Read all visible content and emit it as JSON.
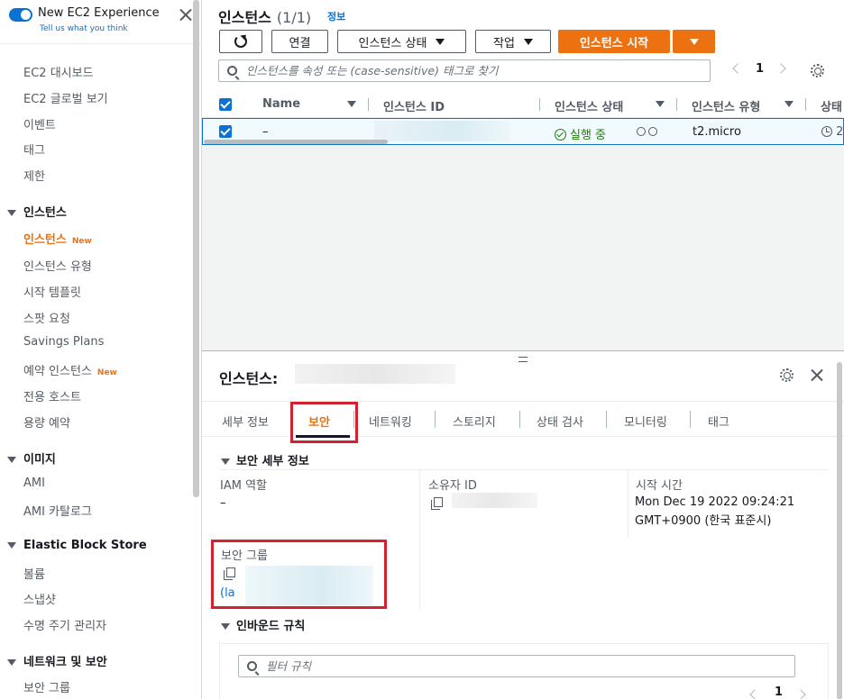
{
  "sidebar": {
    "experience_title": "New EC2 Experience",
    "experience_sub": "Tell us what you think",
    "items_top": [
      "EC2 대시보드",
      "EC2 글로벌 보기",
      "이벤트",
      "태그",
      "제한"
    ],
    "section_instances": "인스턴스",
    "instances_items": {
      "instances": "인스턴스",
      "new_badge": "New",
      "types": "인스턴스 유형",
      "launch_templates": "시작 템플릿",
      "spot": "스팟 요청",
      "savings": "Savings Plans",
      "reserved": "예약 인스턴스",
      "reserved_new": "New",
      "dedicated": "전용 호스트",
      "capacity": "용량 예약"
    },
    "section_images": "이미지",
    "images_items": [
      "AMI",
      "AMI 카탈로그"
    ],
    "section_ebs": "Elastic Block Store",
    "ebs_items": [
      "볼륨",
      "스냅샷",
      "수명 주기 관리자"
    ],
    "section_network": "네트워크 및 보안",
    "network_items": [
      "보안 그룹"
    ]
  },
  "header": {
    "title": "인스턴스",
    "count": "(1/1)",
    "info": "정보",
    "connect": "연결",
    "instance_state": "인스턴스 상태",
    "actions": "작업",
    "launch": "인스턴스 시작",
    "search_placeholder": "인스턴스를 속성 또는 (case-sensitive) 태그로 찾기",
    "page": "1"
  },
  "table": {
    "columns": [
      "Name",
      "인스턴스 ID",
      "인스턴스 상태",
      "인스턴스 유형",
      "상태"
    ],
    "row": {
      "name": "–",
      "state": "실행 중",
      "type": "t2.micro",
      "status": "2"
    }
  },
  "details": {
    "title": "인스턴스:",
    "tabs": [
      "세부 정보",
      "보안",
      "네트워킹",
      "스토리지",
      "상태 검사",
      "모니터링",
      "태그"
    ],
    "security_section": "보안 세부 정보",
    "iam_label": "IAM 역할",
    "iam_value": "–",
    "owner_label": "소유자 ID",
    "launch_label": "시작 시간",
    "launch_value_1": "Mon Dec 19 2022 09:24:21",
    "launch_value_2": "GMT+0900 (한국 표준시)",
    "sg_label": "보안 그룹",
    "sg_link": "(la",
    "inbound_section": "인바운드 규칙",
    "filter_placeholder": "필터 규칙",
    "page": "1"
  },
  "colors": {
    "accent": "#ec7211",
    "link": "#0972d3",
    "success": "#1d8102",
    "highlight": "#d0232f"
  }
}
